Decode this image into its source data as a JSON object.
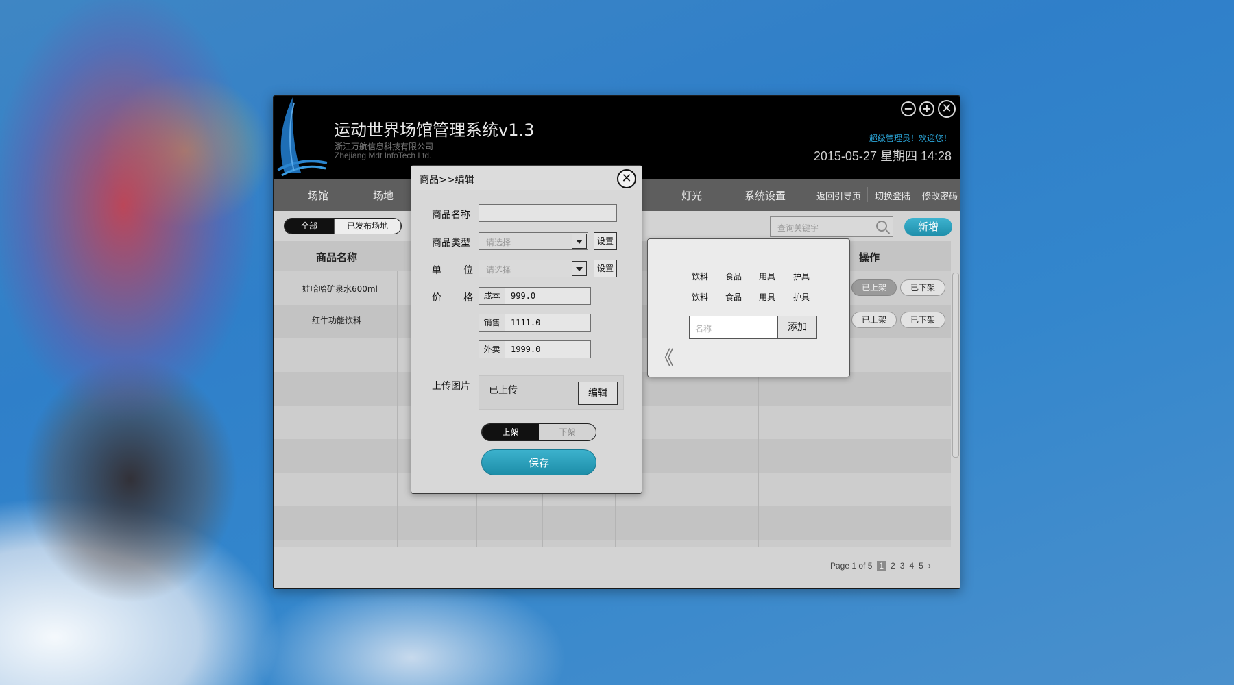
{
  "app": {
    "title": "运动世界场馆管理系统v1.3",
    "company_cn": "浙江万航信息科技有限公司",
    "company_en": "Zhejiang Mdt InfoTech Ltd.",
    "welcome": "超级管理员！欢迎您！",
    "datetime": "2015-05-27 星期四 14:28",
    "window_controls": {
      "minimize": "−",
      "maximize": "+",
      "close": "✕"
    }
  },
  "nav": {
    "items": [
      "场馆",
      "场地",
      "灯光",
      "系统设置"
    ],
    "links": [
      "返回引导页",
      "切换登陆",
      "修改密码"
    ]
  },
  "toolbar": {
    "filters": [
      "全部",
      "已发布场地"
    ],
    "search_placeholder": "查询关键字",
    "add_label": "新增"
  },
  "table": {
    "headers": [
      "商品名称",
      "操作"
    ],
    "rows": [
      {
        "name": "娃哈哈矿泉水600ml",
        "on_label": "已上架",
        "off_label": "已下架"
      },
      {
        "name": "红牛功能饮料",
        "on_label": "已上架",
        "off_label": "已下架"
      }
    ]
  },
  "pager": {
    "summary": "Page 1 of 5",
    "pages": [
      "1",
      "2",
      "3",
      "4",
      "5"
    ],
    "next": "›"
  },
  "dialog": {
    "title": "商品>>编辑",
    "close": "✕",
    "name_label": "商品名称",
    "name_value": "",
    "type_label": "商品类型",
    "type_placeholder": "请选择",
    "unit_label_1": "单",
    "unit_label_2": "位",
    "unit_placeholder": "请选择",
    "settings_label": "设置",
    "price_label_1": "价",
    "price_label_2": "格",
    "prices": [
      {
        "tag": "成本",
        "value": "999.0"
      },
      {
        "tag": "销售",
        "value": "1111.0"
      },
      {
        "tag": "外卖",
        "value": "1999.0"
      }
    ],
    "upload_label": "上传图片",
    "upload_status": "已上传",
    "edit_label": "编辑",
    "status_on": "上架",
    "status_off": "下架",
    "save_label": "保存"
  },
  "popup": {
    "tags": [
      "饮料",
      "食品",
      "用具",
      "护具",
      "饮料",
      "食品",
      "用具",
      "护具"
    ],
    "name_placeholder": "名称",
    "add_label": "添加",
    "collapse": "《"
  }
}
